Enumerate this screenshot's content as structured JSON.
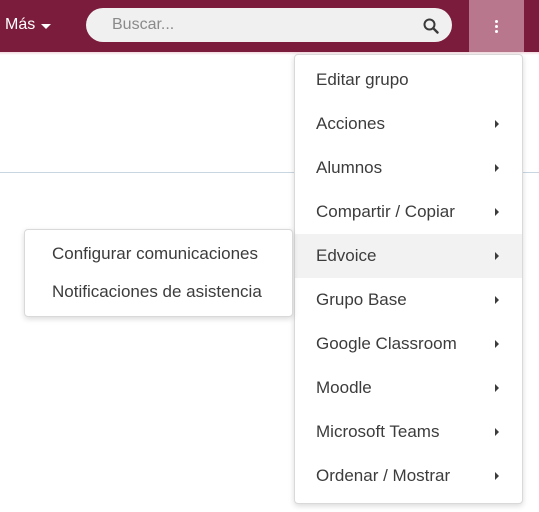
{
  "topbar": {
    "more_label": "Más",
    "search_placeholder": "Buscar..."
  },
  "dropdown": {
    "items": [
      {
        "label": "Editar grupo",
        "has_submenu": false
      },
      {
        "label": "Acciones",
        "has_submenu": true
      },
      {
        "label": "Alumnos",
        "has_submenu": true
      },
      {
        "label": "Compartir / Copiar",
        "has_submenu": true
      },
      {
        "label": "Edvoice",
        "has_submenu": true,
        "active": true
      },
      {
        "label": "Grupo Base",
        "has_submenu": true
      },
      {
        "label": "Google Classroom",
        "has_submenu": true
      },
      {
        "label": "Moodle",
        "has_submenu": true
      },
      {
        "label": "Microsoft Teams",
        "has_submenu": true
      },
      {
        "label": "Ordenar / Mostrar",
        "has_submenu": true
      }
    ]
  },
  "submenu": {
    "items": [
      {
        "label": "Configurar comunicaciones"
      },
      {
        "label": "Notificaciones de asistencia"
      }
    ]
  },
  "colors": {
    "topbar": "#7c1c3c",
    "kebab_active": "#b8778c",
    "menu_text": "#3c3c3c",
    "active_item_bg": "#f2f2f2"
  },
  "icons": [
    "caret-down-icon",
    "search-icon",
    "kebab-icon",
    "caret-right-icon"
  ]
}
